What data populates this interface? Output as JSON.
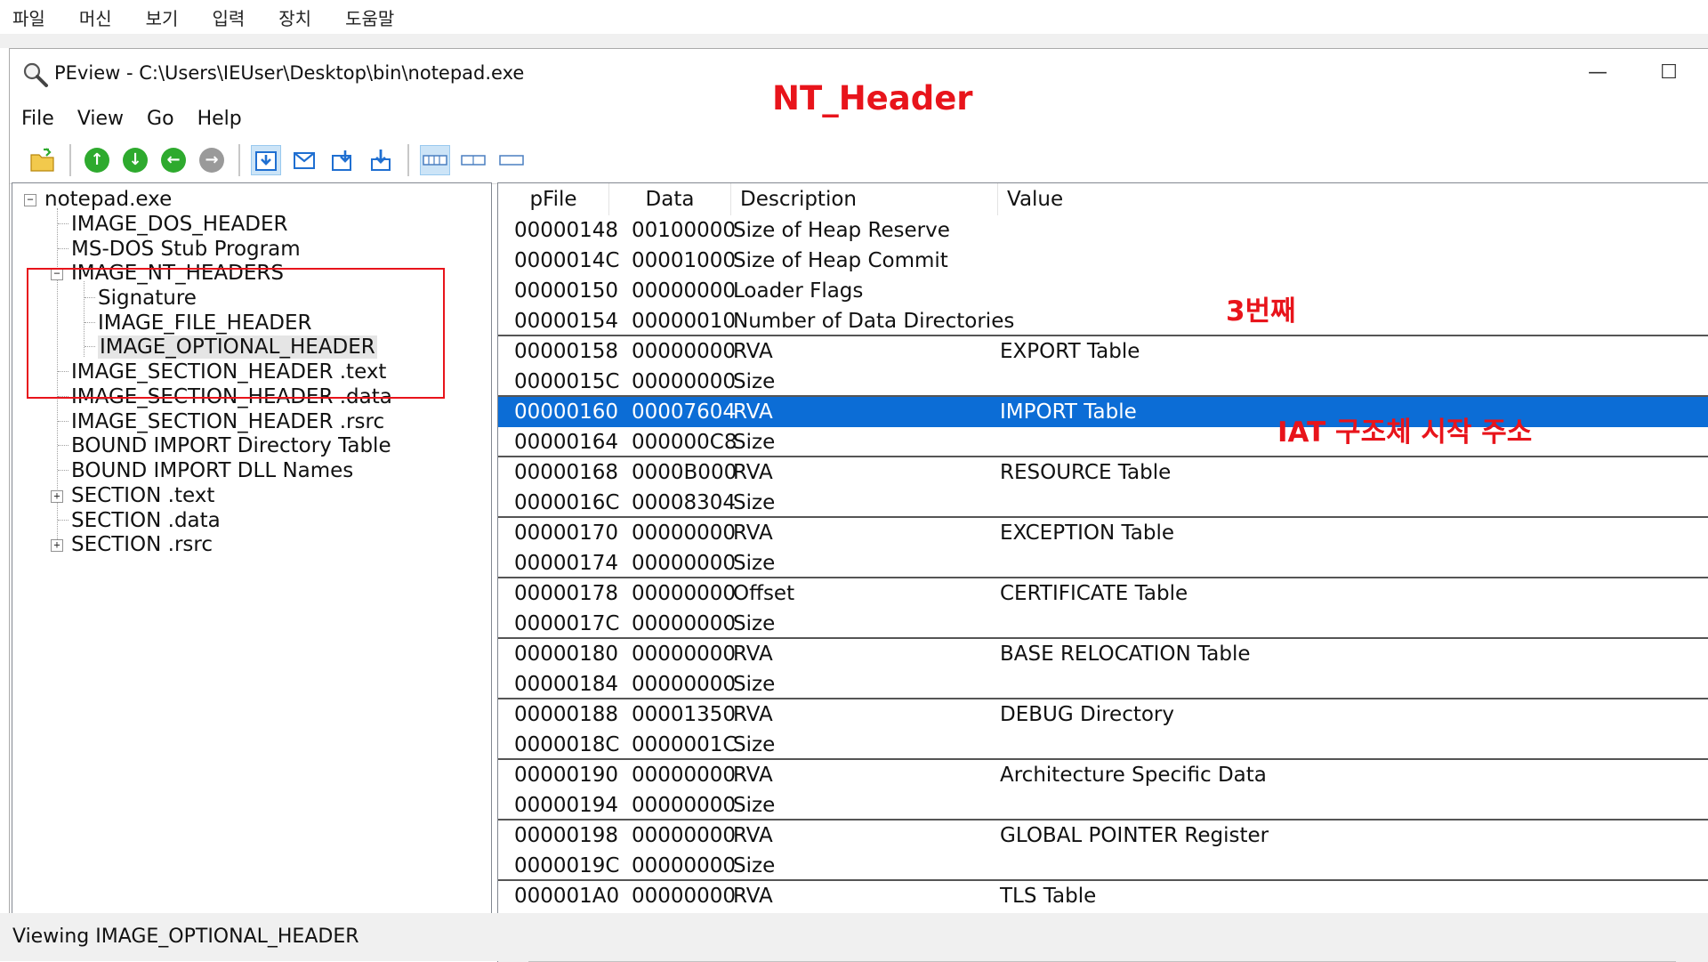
{
  "host_menu": [
    "파일",
    "머신",
    "보기",
    "입력",
    "장치",
    "도움말"
  ],
  "window": {
    "title": "PEview - C:\\Users\\IEUser\\Desktop\\bin\\notepad.exe",
    "minimize_glyph": "—",
    "maximize_glyph": "☐"
  },
  "menu": [
    "File",
    "View",
    "Go",
    "Help"
  ],
  "tree": {
    "root": "notepad.exe",
    "items": [
      "IMAGE_DOS_HEADER",
      "MS-DOS Stub Program",
      "IMAGE_NT_HEADERS",
      "Signature",
      "IMAGE_FILE_HEADER",
      "IMAGE_OPTIONAL_HEADER",
      "IMAGE_SECTION_HEADER .text",
      "IMAGE_SECTION_HEADER .data",
      "IMAGE_SECTION_HEADER .rsrc",
      "BOUND IMPORT Directory Table",
      "BOUND IMPORT DLL Names",
      "SECTION .text",
      "SECTION .data",
      "SECTION .rsrc"
    ],
    "expander_minus": "−",
    "expander_plus": "+"
  },
  "table": {
    "columns": [
      "pFile",
      "Data",
      "Description",
      "Value"
    ],
    "rows": [
      [
        "00000148",
        "00100000",
        "Size of Heap Reserve",
        ""
      ],
      [
        "0000014C",
        "00001000",
        "Size of Heap Commit",
        ""
      ],
      [
        "00000150",
        "00000000",
        "Loader Flags",
        ""
      ],
      [
        "00000154",
        "00000010",
        "Number of Data Directories",
        ""
      ],
      [
        "00000158",
        "00000000",
        "RVA",
        "EXPORT Table"
      ],
      [
        "0000015C",
        "00000000",
        "Size",
        ""
      ],
      [
        "00000160",
        "00007604",
        "RVA",
        "IMPORT Table"
      ],
      [
        "00000164",
        "000000C8",
        "Size",
        ""
      ],
      [
        "00000168",
        "0000B000",
        "RVA",
        "RESOURCE Table"
      ],
      [
        "0000016C",
        "00008304",
        "Size",
        ""
      ],
      [
        "00000170",
        "00000000",
        "RVA",
        "EXCEPTION Table"
      ],
      [
        "00000174",
        "00000000",
        "Size",
        ""
      ],
      [
        "00000178",
        "00000000",
        "Offset",
        "CERTIFICATE Table"
      ],
      [
        "0000017C",
        "00000000",
        "Size",
        ""
      ],
      [
        "00000180",
        "00000000",
        "RVA",
        "BASE RELOCATION Table"
      ],
      [
        "00000184",
        "00000000",
        "Size",
        ""
      ],
      [
        "00000188",
        "00001350",
        "RVA",
        "DEBUG Directory"
      ],
      [
        "0000018C",
        "0000001C",
        "Size",
        ""
      ],
      [
        "00000190",
        "00000000",
        "RVA",
        "Architecture Specific Data"
      ],
      [
        "00000194",
        "00000000",
        "Size",
        ""
      ],
      [
        "00000198",
        "00000000",
        "RVA",
        "GLOBAL POINTER Register"
      ],
      [
        "0000019C",
        "00000000",
        "Size",
        ""
      ],
      [
        "000001A0",
        "00000000",
        "RVA",
        "TLS Table"
      ]
    ],
    "selected_row": 6,
    "scroll_left_glyph": "‹"
  },
  "annotations": {
    "nt_header": "NT_Header",
    "third": "3번째",
    "iat": "IAT 구조체 시작 주소",
    "color": "#e8141b"
  },
  "status": "Viewing IMAGE_OPTIONAL_HEADER",
  "colors": {
    "selection": "#0c6dd6",
    "toolbar_green": "#2eaa2e",
    "toolbar_gray": "#9a9a9a",
    "toolbar_blue": "#1f6fd1"
  }
}
